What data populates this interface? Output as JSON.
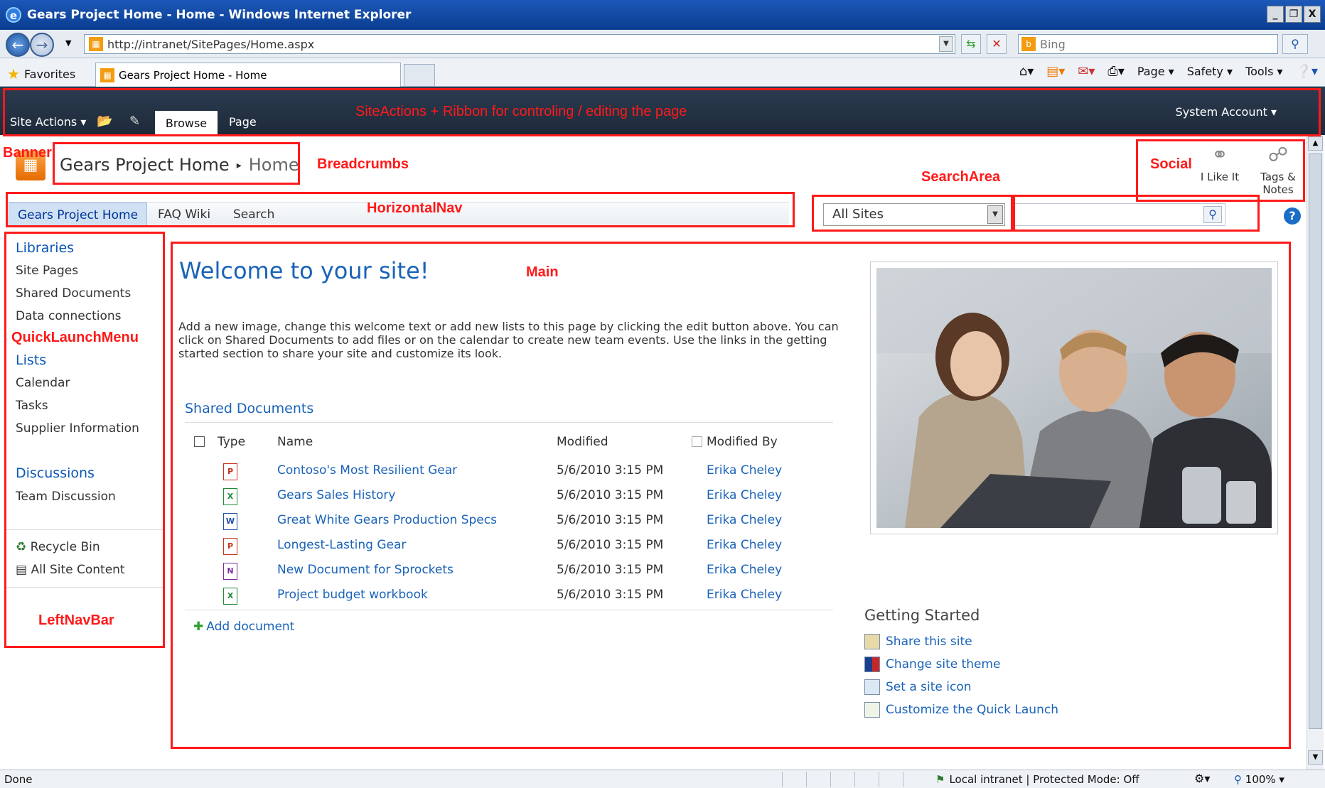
{
  "window": {
    "title": "Gears Project Home - Home - Windows Internet Explorer",
    "buttons": [
      "_",
      "❐",
      "X"
    ]
  },
  "addressbar": {
    "url": "http://intranet/SitePages/Home.aspx",
    "search_placeholder": "Bing"
  },
  "favbar": {
    "favorites_label": "Favorites",
    "tab_title": "Gears Project Home - Home",
    "commands": [
      "Page ▾",
      "Safety ▾",
      "Tools ▾"
    ]
  },
  "ribbon": {
    "site_actions": "Site Actions ▾",
    "tabs": [
      "Browse",
      "Page"
    ],
    "account": "System Account ▾"
  },
  "breadcrumb": {
    "site": "Gears Project Home",
    "separator": "▸",
    "page": "Home"
  },
  "social": {
    "like": "I Like It",
    "tags_line1": "Tags &",
    "tags_line2": "Notes"
  },
  "topnav": {
    "items": [
      "Gears Project Home",
      "FAQ Wiki",
      "Search"
    ]
  },
  "search": {
    "scope": "All Sites",
    "help": "?"
  },
  "leftnav": {
    "libraries": "Libraries",
    "library_items": [
      "Site Pages",
      "Shared Documents",
      "Data connections"
    ],
    "lists": "Lists",
    "list_items": [
      "Calendar",
      "Tasks",
      "Supplier Information"
    ],
    "discussions": "Discussions",
    "discussion_items": [
      "Team Discussion"
    ],
    "recycle_bin": "Recycle Bin",
    "all_content": "All Site Content"
  },
  "main": {
    "welcome": "Welcome to your site!",
    "intro": "Add a new image, change this welcome text or add new lists to this page by clicking the edit button above. You can click on Shared Documents to add files or on the calendar to create new team events. Use the links in the getting started section to share your site and customize its look.",
    "docs_title": "Shared Documents",
    "columns": [
      "Type",
      "Name",
      "Modified",
      "Modified By"
    ],
    "documents": [
      {
        "type": "ppt",
        "icon_letter": "P",
        "icon_color": "#c8331f",
        "name": "Contoso's Most Resilient Gear",
        "modified": "5/6/2010 3:15 PM",
        "by": "Erika Cheley"
      },
      {
        "type": "xls",
        "icon_letter": "X",
        "icon_color": "#1f8a36",
        "name": "Gears Sales History",
        "modified": "5/6/2010 3:15 PM",
        "by": "Erika Cheley"
      },
      {
        "type": "doc",
        "icon_letter": "W",
        "icon_color": "#1f4fa8",
        "name": "Great White Gears Production Specs",
        "modified": "5/6/2010 3:15 PM",
        "by": "Erika Cheley"
      },
      {
        "type": "ppt",
        "icon_letter": "P",
        "icon_color": "#c8331f",
        "name": "Longest-Lasting Gear",
        "modified": "5/6/2010 3:15 PM",
        "by": "Erika Cheley"
      },
      {
        "type": "one",
        "icon_letter": "N",
        "icon_color": "#7b2c9e",
        "name": "New Document for Sprockets",
        "modified": "5/6/2010 3:15 PM",
        "by": "Erika Cheley"
      },
      {
        "type": "xls",
        "icon_letter": "X",
        "icon_color": "#1f8a36",
        "name": "Project budget workbook",
        "modified": "5/6/2010 3:15 PM",
        "by": "Erika Cheley"
      }
    ],
    "add_document": "Add document"
  },
  "getting_started": {
    "title": "Getting Started",
    "items": [
      "Share this site",
      "Change site theme",
      "Set a site icon",
      "Customize the Quick Launch"
    ]
  },
  "statusbar": {
    "left": "Done",
    "zone": "Local intranet | Protected Mode: Off",
    "zoom": "100% ▾"
  },
  "annotations": {
    "siteactions": "SiteActions + Ribbon for controling / editing the page",
    "banner": "Banner",
    "breadcrumbs": "Breadcrumbs",
    "searcharea": "SearchArea",
    "social": "Social",
    "horizontalnav": "HorizontalNav",
    "main": "Main",
    "quicklaunch": "QuickLaunchMenu",
    "leftnavbar": "LeftNavBar"
  }
}
